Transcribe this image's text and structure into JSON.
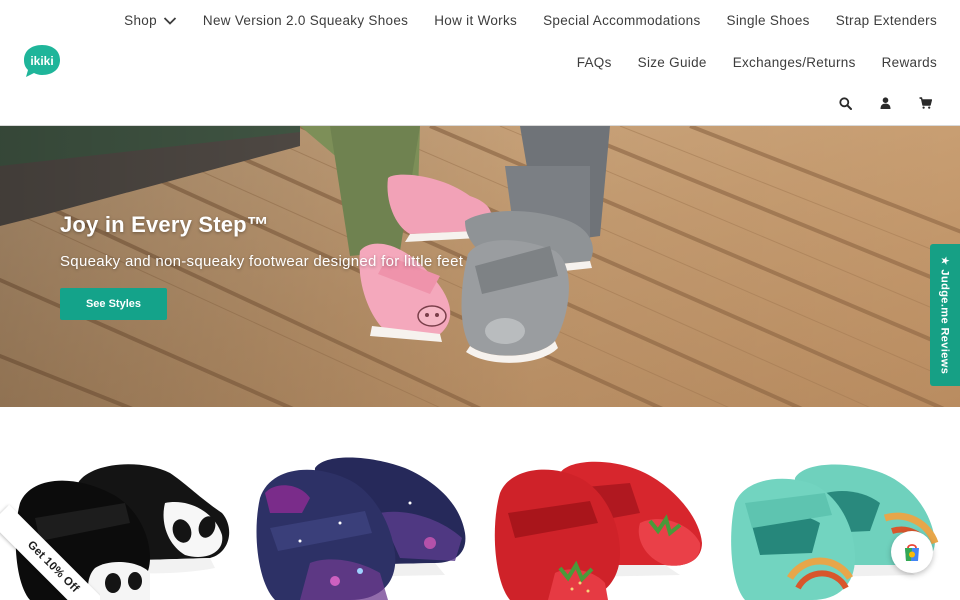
{
  "brand": {
    "logo_text": "ikiki",
    "logo_color": "#1fb59a"
  },
  "nav": {
    "row1": [
      {
        "label": "Shop",
        "has_dropdown": true
      },
      {
        "label": "New Version 2.0 Squeaky Shoes"
      },
      {
        "label": "How it Works"
      },
      {
        "label": "Special Accommodations"
      },
      {
        "label": "Single Shoes"
      },
      {
        "label": "Strap Extenders"
      }
    ],
    "row2": [
      {
        "label": "FAQs"
      },
      {
        "label": "Size Guide"
      },
      {
        "label": "Exchanges/Returns"
      },
      {
        "label": "Rewards"
      }
    ],
    "icons": [
      "search-icon",
      "account-icon",
      "cart-icon"
    ]
  },
  "hero": {
    "title": "Joy in Every Step™",
    "subtitle": "Squeaky and non-squeaky footwear designed for little feet",
    "cta_label": "See Styles",
    "cta_color": "#14a38a"
  },
  "judge_me": {
    "label": "★ Judge.me Reviews",
    "color": "#16a085"
  },
  "products": [
    {
      "image": "panda-shoes"
    },
    {
      "image": "galaxy-shoes"
    },
    {
      "image": "strawberry-sandals"
    },
    {
      "image": "rainbow-sandals"
    }
  ],
  "promo": {
    "label": "Get 10% Off"
  },
  "floating_button": {
    "icon": "shopping-bag-icon"
  }
}
